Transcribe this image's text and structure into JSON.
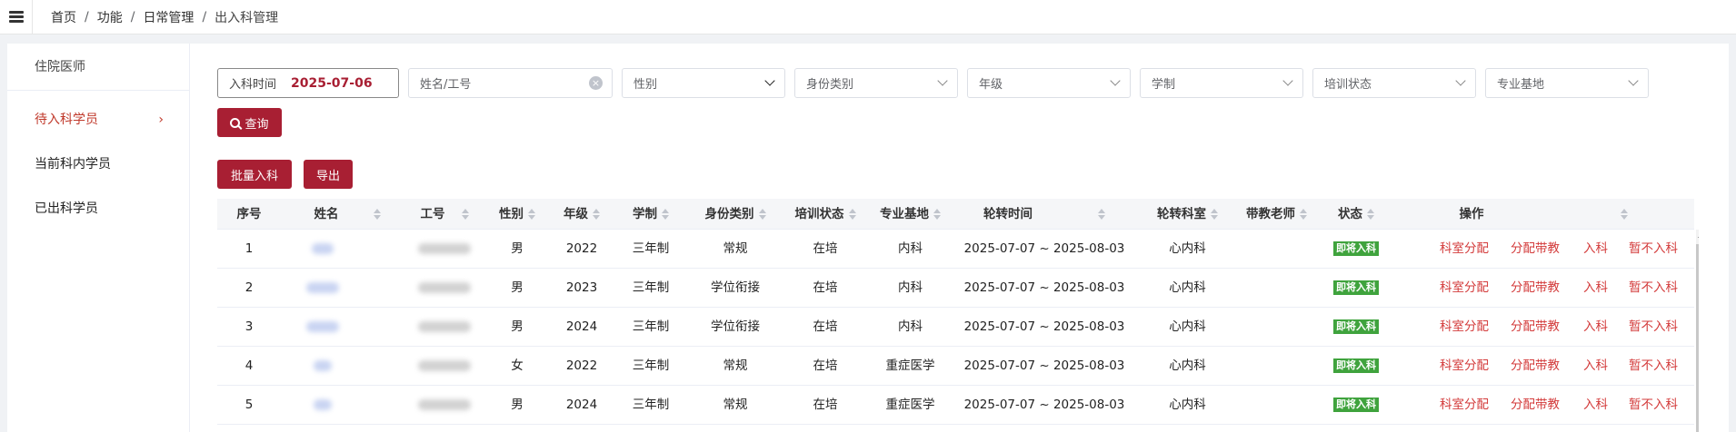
{
  "breadcrumb": [
    "首页",
    "功能",
    "日常管理",
    "出入科管理"
  ],
  "sidebar": {
    "title": "住院医师",
    "items": [
      {
        "label": "待入科学员",
        "active": true
      },
      {
        "label": "当前科内学员"
      },
      {
        "label": "已出科学员"
      }
    ]
  },
  "filters": {
    "date_label": "入科时间",
    "date_value": "2025-07-06",
    "name_placeholder": "姓名/工号",
    "gender": "性别",
    "identity": "身份类别",
    "grade": "年级",
    "system": "学制",
    "training_status": "培训状态",
    "base": "专业基地"
  },
  "buttons": {
    "query": "查询",
    "batch": "批量入科",
    "export": "导出"
  },
  "table": {
    "headers": [
      "序号",
      "姓名",
      "工号",
      "性别",
      "年级",
      "学制",
      "身份类别",
      "培训状态",
      "专业基地",
      "轮转时间",
      "轮转科室",
      "带教老师",
      "状态",
      "操作"
    ],
    "rows": [
      {
        "no": "1",
        "gender": "男",
        "grade": "2022",
        "system": "三年制",
        "identity": "常规",
        "training": "在培",
        "base": "内科",
        "period": "2025-07-07 ~ 2025-08-03",
        "dept": "心内科",
        "teacher": "",
        "status": "即将入科"
      },
      {
        "no": "2",
        "gender": "男",
        "grade": "2023",
        "system": "三年制",
        "identity": "学位衔接",
        "training": "在培",
        "base": "内科",
        "period": "2025-07-07 ~ 2025-08-03",
        "dept": "心内科",
        "teacher": "",
        "status": "即将入科"
      },
      {
        "no": "3",
        "gender": "男",
        "grade": "2024",
        "system": "三年制",
        "identity": "学位衔接",
        "training": "在培",
        "base": "内科",
        "period": "2025-07-07 ~ 2025-08-03",
        "dept": "心内科",
        "teacher": "",
        "status": "即将入科"
      },
      {
        "no": "4",
        "gender": "女",
        "grade": "2022",
        "system": "三年制",
        "identity": "常规",
        "training": "在培",
        "base": "重症医学",
        "period": "2025-07-07 ~ 2025-08-03",
        "dept": "心内科",
        "teacher": "",
        "status": "即将入科"
      },
      {
        "no": "5",
        "gender": "男",
        "grade": "2024",
        "system": "三年制",
        "identity": "常规",
        "training": "在培",
        "base": "重症医学",
        "period": "2025-07-07 ~ 2025-08-03",
        "dept": "心内科",
        "teacher": "",
        "status": "即将入科"
      }
    ],
    "operations": [
      "科室分配",
      "分配带教",
      "入科",
      "暂不入科"
    ]
  },
  "colors": {
    "accent": "#a81f33",
    "link": "#d33a3a",
    "badge": "#3fa33d"
  }
}
